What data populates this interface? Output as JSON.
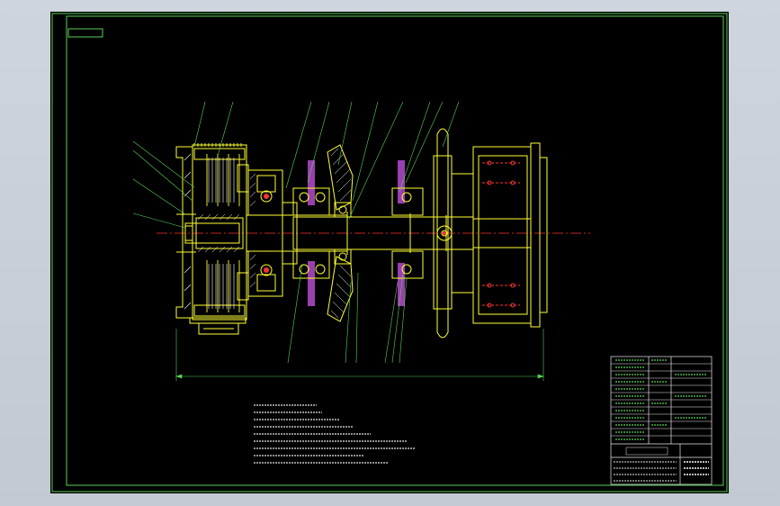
{
  "colors": {
    "background": "#000000",
    "frame": "#5ad15a",
    "part_outline": "#ffff33",
    "hatch": "#ffffff",
    "center_line": "#ff3333",
    "leader": "#5ad15a",
    "gear_fill": "#9a3fb0",
    "notes_text": "#e8e8e8"
  },
  "drawing": {
    "stamp_label": "",
    "notes_title": "",
    "title_block_label": "",
    "title_block_sheet": ""
  }
}
